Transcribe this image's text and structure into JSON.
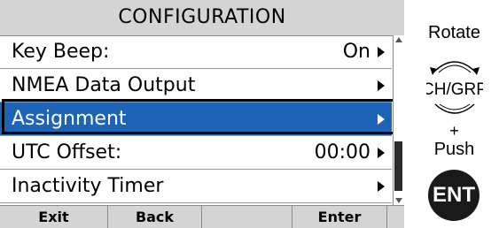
{
  "screen": {
    "title": "CONFIGURATION",
    "menu": [
      {
        "label": "Key Beep:",
        "value": "On"
      },
      {
        "label": "NMEA Data Output",
        "value": ""
      },
      {
        "label": "Assignment",
        "value": "",
        "selected": true
      },
      {
        "label": "UTC Offset:",
        "value": "00:00"
      },
      {
        "label": "Inactivity Timer",
        "value": ""
      }
    ],
    "softkeys": [
      "Exit",
      "Back",
      "",
      "Enter"
    ],
    "selection_color": "#1d63b6"
  },
  "instruction": {
    "rotate": "Rotate",
    "knob": "CH/GRP",
    "plus": "+",
    "push": "Push",
    "ent": "ENT"
  }
}
